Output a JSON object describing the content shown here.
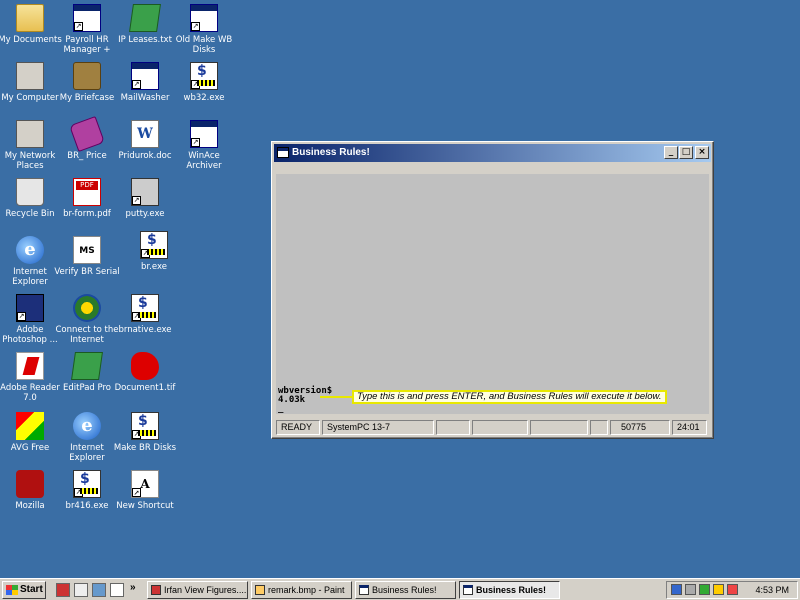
{
  "desktop_icons": [
    {
      "label": "My Documents"
    },
    {
      "label": "Payroll HR Manager +"
    },
    {
      "label": "IP Leases.txt"
    },
    {
      "label": "Old Make WB Disks"
    },
    {
      "label": "My Computer"
    },
    {
      "label": "My Briefcase"
    },
    {
      "label": "MailWasher"
    },
    {
      "label": "wb32.exe"
    },
    {
      "label": "My Network Places"
    },
    {
      "label": "BR_ Price"
    },
    {
      "label": "Pridurok.doc"
    },
    {
      "label": "WinAce Archiver"
    },
    {
      "label": "Recycle Bin"
    },
    {
      "label": "br-form.pdf"
    },
    {
      "label": "putty.exe"
    },
    {
      "label": "Internet Explorer"
    },
    {
      "label": "Verify BR Serial"
    },
    {
      "label": "br.exe"
    },
    {
      "label": "Adobe Photoshop ..."
    },
    {
      "label": "Connect to the Internet"
    },
    {
      "label": "brnative.exe"
    },
    {
      "label": "Adobe Reader 7.0"
    },
    {
      "label": "EditPad Pro"
    },
    {
      "label": "Document1.tif"
    },
    {
      "label": "AVG Free"
    },
    {
      "label": "Internet Explorer"
    },
    {
      "label": "Make BR Disks"
    },
    {
      "label": "Mozilla"
    },
    {
      "label": "br416.exe"
    },
    {
      "label": "New Shortcut"
    }
  ],
  "window": {
    "title": "Business Rules!",
    "buttons": {
      "minimize": "_",
      "maximize": "□",
      "close": "×"
    },
    "console_lines": [
      "wbversion$",
      "4.03k",
      "_"
    ],
    "callout": "Type this is and press ENTER, and Business Rules will execute it below.",
    "status": [
      "READY",
      "SystemPC 13-7",
      "",
      "",
      "",
      "",
      "50775",
      "24:01"
    ]
  },
  "taskbar": {
    "start_label": "Start",
    "overflow": "»",
    "tasks": [
      {
        "label": "Irfan View Figures...."
      },
      {
        "label": "remark.bmp - Paint"
      },
      {
        "label": "Business Rules!"
      },
      {
        "label": "Business Rules!",
        "active": true
      }
    ],
    "clock": "4:53 PM"
  },
  "colors": {
    "desktop": "#3a6ea5",
    "titlebar_start": "#0a246a",
    "titlebar_end": "#a6caf0",
    "callout_border": "#e8e800"
  }
}
